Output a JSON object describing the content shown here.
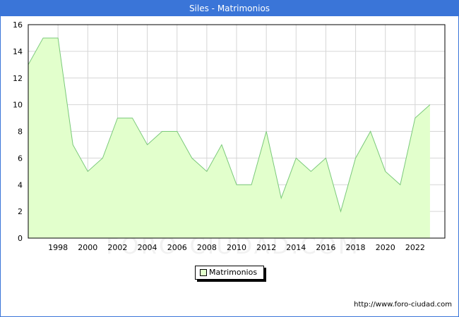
{
  "title": "Siles - Matrimonios",
  "legend_label": "Matrimonios",
  "url": "http://www.foro-ciudad.com",
  "watermark": "FORO-CIUDAD.COM",
  "colors": {
    "title_bg": "#3a75d8",
    "area_fill": "#e2ffcc",
    "area_line": "#7ac97a",
    "grid": "#d6d6d6"
  },
  "chart_data": {
    "type": "area",
    "title": "Siles - Matrimonios",
    "xlabel": "",
    "ylabel": "",
    "x": [
      1996,
      1997,
      1998,
      1999,
      2000,
      2001,
      2002,
      2003,
      2004,
      2005,
      2006,
      2007,
      2008,
      2009,
      2010,
      2011,
      2012,
      2013,
      2014,
      2015,
      2016,
      2017,
      2018,
      2019,
      2020,
      2021,
      2022,
      2023
    ],
    "series": [
      {
        "name": "Matrimonios",
        "values": [
          13,
          15,
          15,
          7,
          5,
          6,
          9,
          9,
          7,
          8,
          8,
          6,
          5,
          7,
          4,
          4,
          8,
          3,
          6,
          5,
          6,
          2,
          6,
          8,
          5,
          4,
          9,
          10
        ]
      }
    ],
    "xlim": [
      1996,
      2024
    ],
    "ylim": [
      0,
      16
    ],
    "xticks": [
      1998,
      2000,
      2002,
      2004,
      2006,
      2008,
      2010,
      2012,
      2014,
      2016,
      2018,
      2020,
      2022
    ],
    "yticks": [
      0,
      2,
      4,
      6,
      8,
      10,
      12,
      14,
      16
    ],
    "grid": true,
    "legend_position": "bottom-center"
  }
}
